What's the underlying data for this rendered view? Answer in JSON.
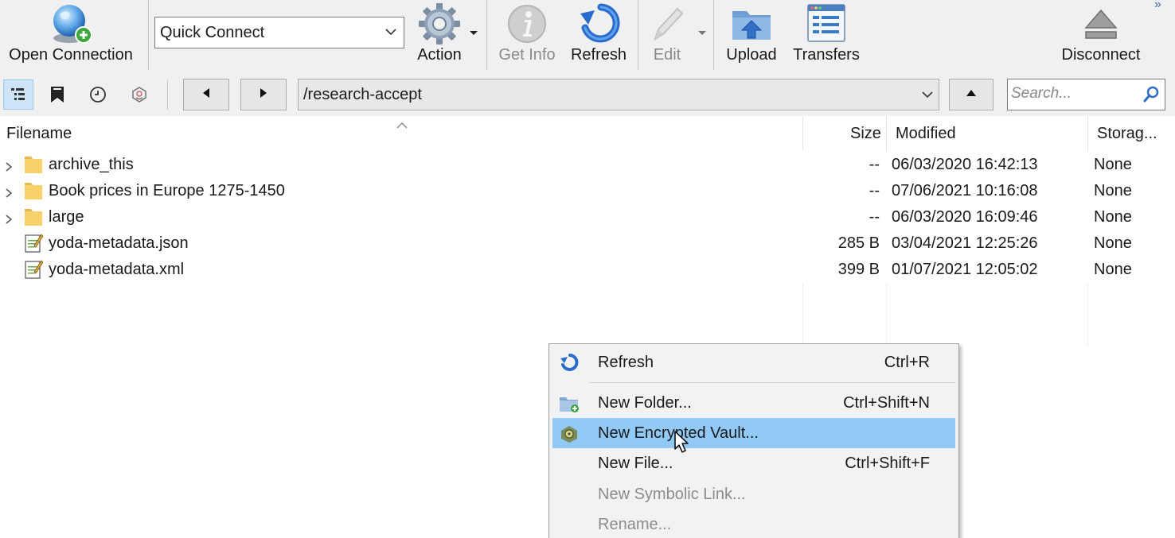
{
  "toolbar": {
    "open_connection": "Open Connection",
    "quick_connect": "Quick Connect",
    "action": "Action",
    "get_info": "Get Info",
    "refresh": "Refresh",
    "edit": "Edit",
    "upload": "Upload",
    "transfers": "Transfers",
    "disconnect": "Disconnect",
    "overflow": "»"
  },
  "navbar": {
    "path": "/research-accept",
    "search_placeholder": "Search..."
  },
  "columns": {
    "filename": "Filename",
    "size": "Size",
    "modified": "Modified",
    "storage": "Storag..."
  },
  "files": [
    {
      "name": "archive_this",
      "type": "folder",
      "size": "--",
      "modified": "06/03/2020 16:42:13",
      "storage": "None"
    },
    {
      "name": "Book prices in Europe 1275-1450",
      "type": "folder",
      "size": "--",
      "modified": "07/06/2021 10:16:08",
      "storage": "None"
    },
    {
      "name": "large",
      "type": "folder",
      "size": "--",
      "modified": "06/03/2020 16:09:46",
      "storage": "None"
    },
    {
      "name": "yoda-metadata.json",
      "type": "file",
      "size": "285 B",
      "modified": "03/04/2021 12:25:26",
      "storage": "None"
    },
    {
      "name": "yoda-metadata.xml",
      "type": "file",
      "size": "399 B",
      "modified": "01/07/2021 12:05:02",
      "storage": "None"
    }
  ],
  "context_menu": {
    "items": [
      {
        "label": "Refresh",
        "shortcut": "Ctrl+R",
        "icon": "refresh-icon",
        "enabled": true,
        "highlighted": false
      },
      {
        "label": "New Folder...",
        "shortcut": "Ctrl+Shift+N",
        "icon": "new-folder-icon",
        "enabled": true,
        "highlighted": false
      },
      {
        "label": "New Encrypted Vault...",
        "shortcut": "",
        "icon": "vault-icon",
        "enabled": true,
        "highlighted": true
      },
      {
        "label": "New File...",
        "shortcut": "Ctrl+Shift+F",
        "icon": "",
        "enabled": true,
        "highlighted": false
      },
      {
        "label": "New Symbolic Link...",
        "shortcut": "",
        "icon": "",
        "enabled": false,
        "highlighted": false
      },
      {
        "label": "Rename...",
        "shortcut": "",
        "icon": "",
        "enabled": false,
        "highlighted": false
      }
    ]
  },
  "colors": {
    "toolbar_bg": "#f0f0f0",
    "menu_highlight": "#91c9f7",
    "nav_active": "#cde3f7",
    "folder": "#f7d26b",
    "accent_blue": "#2f7ad6"
  }
}
